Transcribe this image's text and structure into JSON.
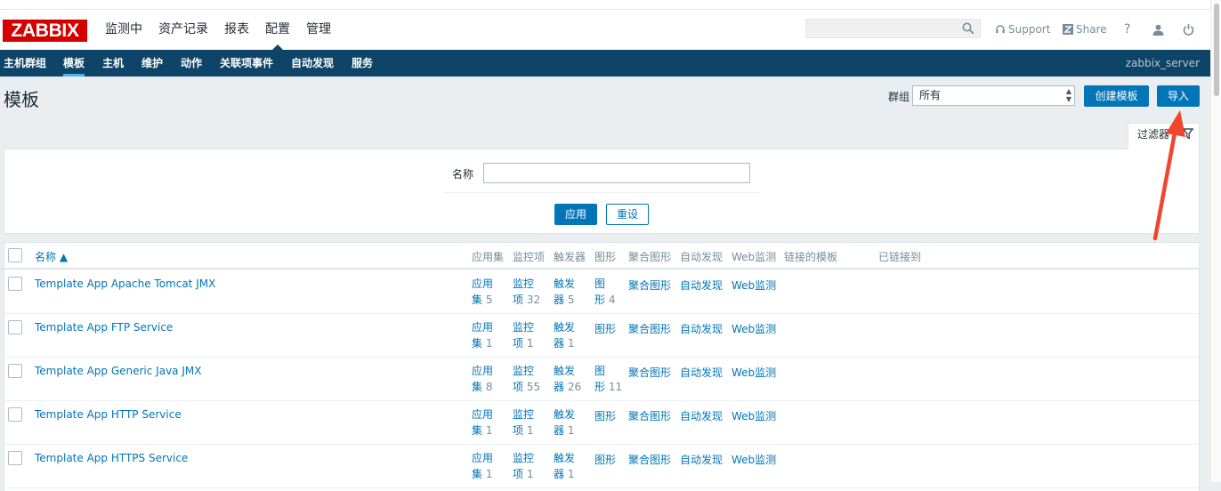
{
  "header": {
    "logo": "ZABBIX",
    "menu": [
      "监测中",
      "资产记录",
      "报表",
      "配置",
      "管理"
    ],
    "active_menu": "配置",
    "support_label": "Support",
    "share_label": "Share",
    "help_label": "?"
  },
  "subnav": {
    "items": [
      "主机群组",
      "模板",
      "主机",
      "维护",
      "动作",
      "关联项事件",
      "自动发现",
      "服务"
    ],
    "active": "模板",
    "server": "zabbix_server"
  },
  "page": {
    "title": "模板",
    "group_label": "群组",
    "group_value": "所有",
    "create_button": "创建模板",
    "import_button": "导入"
  },
  "filter": {
    "tab_label": "过滤器",
    "name_label": "名称",
    "name_value": "",
    "apply": "应用",
    "reset": "重设"
  },
  "table": {
    "headers": [
      "名称 ▲",
      "应用集",
      "监控项",
      "触发器",
      "图形",
      "聚合图形",
      "自动发现",
      "Web监测",
      "链接的模板",
      "已链接到"
    ],
    "rows": [
      {
        "name": "Template App Apache Tomcat JMX",
        "apps_a": "应用",
        "apps_b": "集",
        "apps_n": "5",
        "items_a": "监控",
        "items_b": "项",
        "items_n": "32",
        "trig_a": "触发",
        "trig_b": "器",
        "trig_n": "5",
        "graph_a": "图",
        "graph_b": "形",
        "graph_n": "4",
        "screens": "聚合图形",
        "discovery": "自动发现",
        "web": "Web监测"
      },
      {
        "name": "Template App FTP Service",
        "apps_a": "应用",
        "apps_b": "集",
        "apps_n": "1",
        "items_a": "监控",
        "items_b": "项",
        "items_n": "1",
        "trig_a": "触发",
        "trig_b": "器",
        "trig_n": "1",
        "graph_a": "图形",
        "graph_b": "",
        "graph_n": "",
        "screens": "聚合图形",
        "discovery": "自动发现",
        "web": "Web监测"
      },
      {
        "name": "Template App Generic Java JMX",
        "apps_a": "应用",
        "apps_b": "集",
        "apps_n": "8",
        "items_a": "监控",
        "items_b": "项",
        "items_n": "55",
        "trig_a": "触发",
        "trig_b": "器",
        "trig_n": "26",
        "graph_a": "图",
        "graph_b": "形",
        "graph_n": "11",
        "screens": "聚合图形",
        "discovery": "自动发现",
        "web": "Web监测"
      },
      {
        "name": "Template App HTTP Service",
        "apps_a": "应用",
        "apps_b": "集",
        "apps_n": "1",
        "items_a": "监控",
        "items_b": "项",
        "items_n": "1",
        "trig_a": "触发",
        "trig_b": "器",
        "trig_n": "1",
        "graph_a": "图形",
        "graph_b": "",
        "graph_n": "",
        "screens": "聚合图形",
        "discovery": "自动发现",
        "web": "Web监测"
      },
      {
        "name": "Template App HTTPS Service",
        "apps_a": "应用",
        "apps_b": "集",
        "apps_n": "1",
        "items_a": "监控",
        "items_b": "项",
        "items_n": "1",
        "trig_a": "触发",
        "trig_b": "器",
        "trig_n": "1",
        "graph_a": "图形",
        "graph_b": "",
        "graph_n": "",
        "screens": "聚合图形",
        "discovery": "自动发现",
        "web": "Web监测"
      }
    ]
  },
  "colors": {
    "brand": "#d40000",
    "nav": "#0e4468",
    "link": "#0275b8",
    "annotation_arrow": "#f2452e"
  }
}
